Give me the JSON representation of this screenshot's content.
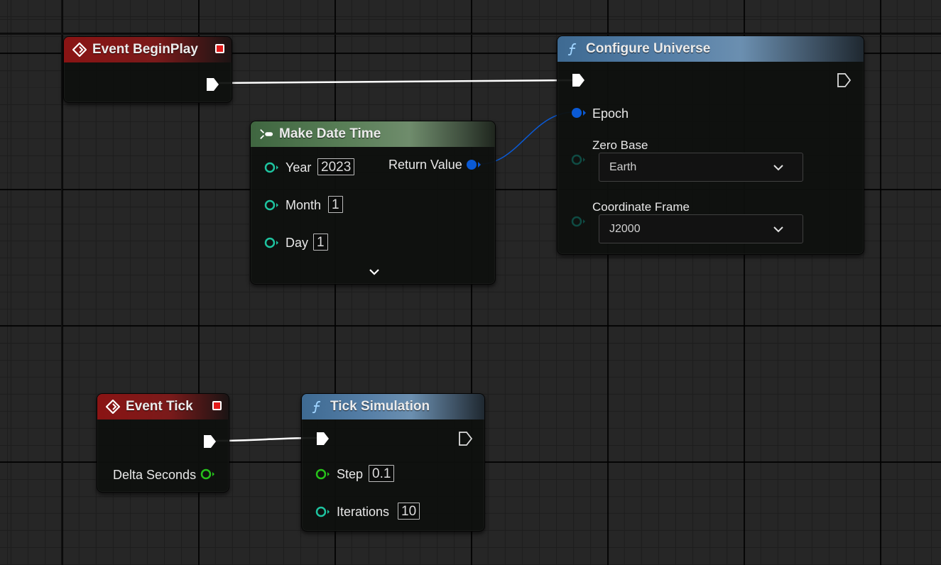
{
  "nodes": {
    "begin_play": {
      "title": "Event BeginPlay"
    },
    "configure_universe": {
      "title": "Configure Universe",
      "epoch_label": "Epoch",
      "zero_base_label": "Zero Base",
      "zero_base_value": "Earth",
      "frame_label": "Coordinate Frame",
      "frame_value": "J2000"
    },
    "make_date_time": {
      "title": "Make Date Time",
      "year_label": "Year",
      "year_value": "2023",
      "month_label": "Month",
      "month_value": "1",
      "day_label": "Day",
      "day_value": "1",
      "return_label": "Return Value"
    },
    "event_tick": {
      "title": "Event Tick",
      "delta_label": "Delta Seconds"
    },
    "tick_simulation": {
      "title": "Tick Simulation",
      "step_label": "Step",
      "step_value": "0.1",
      "iterations_label": "Iterations",
      "iterations_value": "10"
    }
  },
  "colors": {
    "event_header": "#8a1414",
    "function_header": "#557ea6",
    "pure_header": "#5a7f58",
    "exec_pin": "#ffffff",
    "struct_pin": "#0a5ad6",
    "float_pin": "#27c21b",
    "teal_pin": "#1ec4a0",
    "wire_exec": "#ffffff",
    "wire_struct": "#0a5ad6"
  },
  "icons": {
    "event": "event-diamond-icon",
    "function": "function-f-icon",
    "pure": "make-struct-icon",
    "dropdown": "chevron-down-icon",
    "expand": "expand-chevron-icon"
  }
}
